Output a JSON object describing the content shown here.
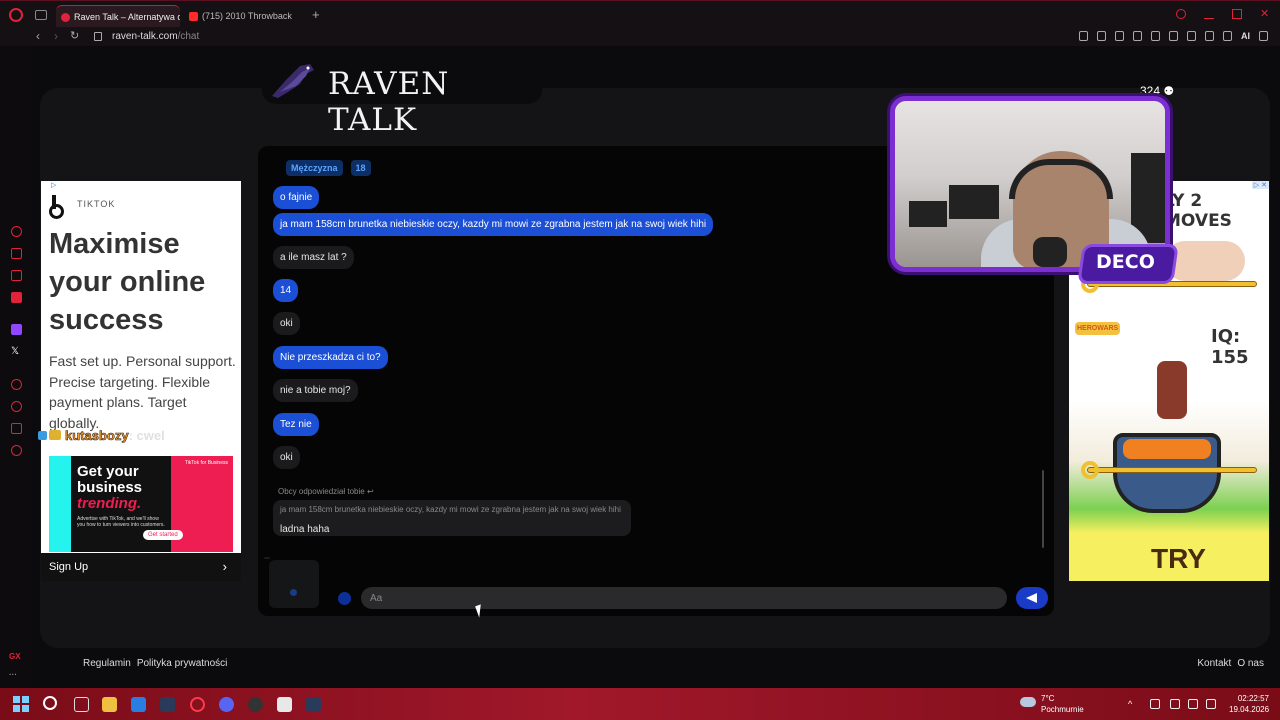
{
  "browser": {
    "tabs": [
      {
        "label": "Raven Talk – Alternatywa d",
        "active": true
      },
      {
        "label": "(715) 2010 Throwback",
        "active": false
      }
    ],
    "url_host": "raven-talk.com",
    "url_path": "/chat",
    "toolbar_ai_label": "AI",
    "sidebar_badge": "GX"
  },
  "site": {
    "logo_text": "RAVEN TALK",
    "online_count": "324"
  },
  "ad_left": {
    "brand": "TIKTOK",
    "headline": "Maximise your online success",
    "body": "Fast set up. Personal support. Precise targeting. Flexible payment plans. Target globally.",
    "banner_line1": "Get your",
    "banner_line2": "business",
    "banner_line3": "trending.",
    "banner_small": "Advertise with TikTok, and we'll show you how to turn viewers into customers.",
    "banner_tag": "TikTok for Business",
    "banner_cta": "Get started",
    "cta": "Sign Up"
  },
  "stream_overlay": {
    "user": "kutasbozy",
    "message": ": cwel"
  },
  "ad_right": {
    "headline": "LY 2 MOVES",
    "iq": "IQ: 155",
    "game_logo": "HEROWARS",
    "cta": "TRY"
  },
  "webcam": {
    "badge": "DECO"
  },
  "chat": {
    "partner_gender": "Mężczyzna",
    "partner_age": "18",
    "messages": [
      {
        "from": "me",
        "text": "o fajnie"
      },
      {
        "from": "me",
        "text": "ja mam 158cm brunetka niebieskie oczy, kazdy mi mowi ze zgrabna jestem jak na swoj wiek hihi"
      },
      {
        "from": "them",
        "text": "a ile masz lat ?"
      },
      {
        "from": "me",
        "text": "14"
      },
      {
        "from": "them",
        "text": "oki"
      },
      {
        "from": "me",
        "text": "Nie przeszkadza ci to?"
      },
      {
        "from": "them",
        "text": "nie a tobie moj?"
      },
      {
        "from": "me",
        "text": "Tez nie"
      },
      {
        "from": "them",
        "text": "oki"
      }
    ],
    "reply_label": "Obcy odpowiedział tobie",
    "reply_quoted": "ja mam 158cm brunetka niebieskie oczy, kazdy mi mowi ze zgrabna jestem jak na swoj wiek hihi",
    "reply_text": "ladna haha",
    "input_placeholder": "Aa"
  },
  "footer": {
    "left_links": [
      "Regulamin",
      "Polityka prywatności"
    ],
    "right_links": [
      "Kontakt",
      "O nas"
    ]
  },
  "taskbar": {
    "weather_temp": "7°C",
    "weather_desc": "Pochmurnie",
    "time": "02:22:57",
    "date": "19.04.2026"
  },
  "colors": {
    "accent_blue": "#1a4fd6",
    "opera_red": "#e0223a",
    "webcam_purple": "#7b2fd0"
  }
}
